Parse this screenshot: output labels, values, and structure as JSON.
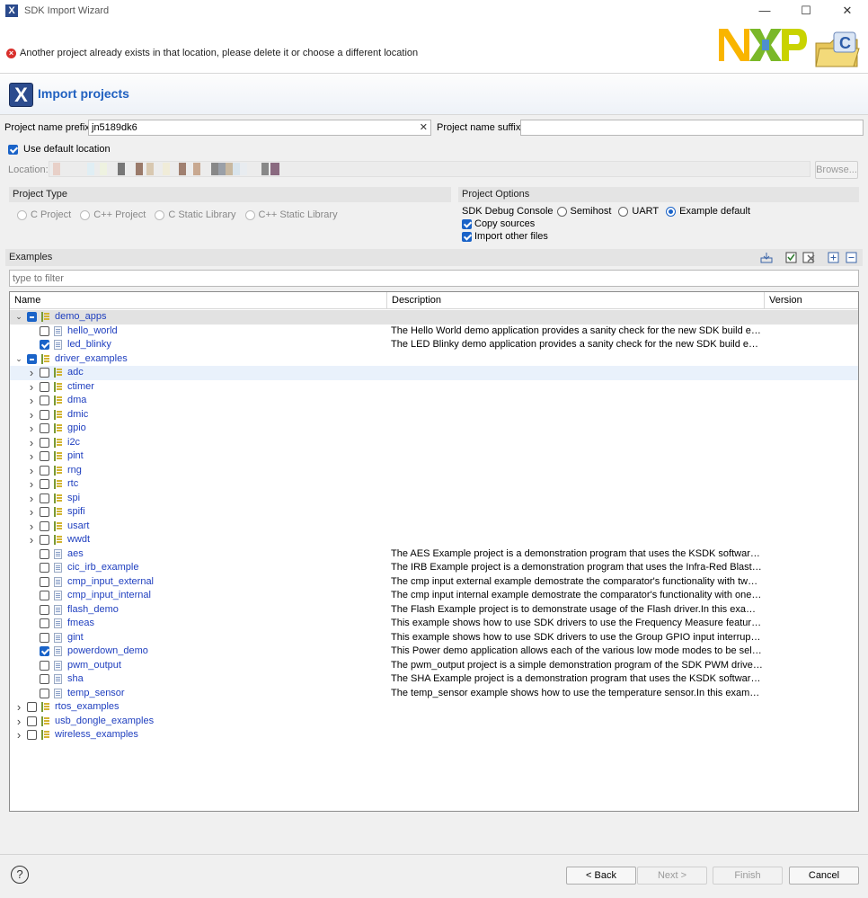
{
  "window": {
    "title": "SDK Import Wizard",
    "minimize": "—",
    "maximize": "☐",
    "close": "✕"
  },
  "banner": {
    "error_message": "Another project already exists in that location, please delete it or choose a different location"
  },
  "header": {
    "title": "Import projects"
  },
  "form": {
    "prefix_label": "Project name prefix:",
    "prefix_value": "jn5189dk6",
    "suffix_label": "Project name suffix:",
    "suffix_value": "",
    "use_default_location": "Use default location",
    "location_label": "Location:",
    "browse": "Browse..."
  },
  "project_type": {
    "title": "Project Type",
    "options": [
      "C Project",
      "C++ Project",
      "C Static Library",
      "C++ Static Library"
    ]
  },
  "project_options": {
    "title": "Project Options",
    "console_label": "SDK Debug Console",
    "console_options": [
      "Semihost",
      "UART",
      "Example default"
    ],
    "copy_sources": "Copy sources",
    "import_other": "Import other files"
  },
  "examples": {
    "title": "Examples",
    "filter_placeholder": "type to filter",
    "columns": [
      "Name",
      "Description",
      "Version"
    ],
    "rows": [
      {
        "level": 0,
        "tw": "open",
        "cb": "partial",
        "icon": "folder",
        "name": "demo_apps",
        "desc": "",
        "sel": true
      },
      {
        "level": 1,
        "tw": "none",
        "cb": "unchecked",
        "icon": "proj",
        "name": "hello_world",
        "desc": "The Hello World demo application provides a sanity check for the new SDK build environment and board bring up."
      },
      {
        "level": 1,
        "tw": "none",
        "cb": "checked",
        "icon": "proj",
        "name": "led_blinky",
        "desc": "The LED Blinky demo application provides a sanity check for the new SDK build environment and board bring up."
      },
      {
        "level": 0,
        "tw": "open",
        "cb": "partial",
        "icon": "folder",
        "name": "driver_examples",
        "desc": ""
      },
      {
        "level": 1,
        "tw": "closed",
        "cb": "unchecked",
        "icon": "folder",
        "name": "adc",
        "desc": "",
        "hov": true
      },
      {
        "level": 1,
        "tw": "closed",
        "cb": "unchecked",
        "icon": "folder",
        "name": "ctimer",
        "desc": ""
      },
      {
        "level": 1,
        "tw": "closed",
        "cb": "unchecked",
        "icon": "folder",
        "name": "dma",
        "desc": ""
      },
      {
        "level": 1,
        "tw": "closed",
        "cb": "unchecked",
        "icon": "folder",
        "name": "dmic",
        "desc": ""
      },
      {
        "level": 1,
        "tw": "closed",
        "cb": "unchecked",
        "icon": "folder",
        "name": "gpio",
        "desc": ""
      },
      {
        "level": 1,
        "tw": "closed",
        "cb": "unchecked",
        "icon": "folder",
        "name": "i2c",
        "desc": ""
      },
      {
        "level": 1,
        "tw": "closed",
        "cb": "unchecked",
        "icon": "folder",
        "name": "pint",
        "desc": ""
      },
      {
        "level": 1,
        "tw": "closed",
        "cb": "unchecked",
        "icon": "folder",
        "name": "rng",
        "desc": ""
      },
      {
        "level": 1,
        "tw": "closed",
        "cb": "unchecked",
        "icon": "folder",
        "name": "rtc",
        "desc": ""
      },
      {
        "level": 1,
        "tw": "closed",
        "cb": "unchecked",
        "icon": "folder",
        "name": "spi",
        "desc": ""
      },
      {
        "level": 1,
        "tw": "closed",
        "cb": "unchecked",
        "icon": "folder",
        "name": "spifi",
        "desc": ""
      },
      {
        "level": 1,
        "tw": "closed",
        "cb": "unchecked",
        "icon": "folder",
        "name": "usart",
        "desc": ""
      },
      {
        "level": 1,
        "tw": "closed",
        "cb": "unchecked",
        "icon": "folder",
        "name": "wwdt",
        "desc": ""
      },
      {
        "level": 1,
        "tw": "none",
        "cb": "unchecked",
        "icon": "proj",
        "name": "aes",
        "desc": "The AES Example project is a demonstration program that uses the KSDK software to encrypt plain text."
      },
      {
        "level": 1,
        "tw": "none",
        "cb": "unchecked",
        "icon": "proj",
        "name": "cic_irb_example",
        "desc": "The IRB Example project is a demonstration program that uses the Infra-Red Blaster (IRB) driver."
      },
      {
        "level": 1,
        "tw": "none",
        "cb": "unchecked",
        "icon": "proj",
        "name": "cmp_input_external",
        "desc": "The cmp input external example demostrate the comparator's functionality with two external inputs."
      },
      {
        "level": 1,
        "tw": "none",
        "cb": "unchecked",
        "icon": "proj",
        "name": "cmp_input_internal",
        "desc": "The cmp input internal example demostrate the comparator's functionality with one external input."
      },
      {
        "level": 1,
        "tw": "none",
        "cb": "unchecked",
        "icon": "proj",
        "name": "flash_demo",
        "desc": "The Flash Example project is to demonstrate usage of the Flash driver.In this example, we will erase."
      },
      {
        "level": 1,
        "tw": "none",
        "cb": "unchecked",
        "icon": "proj",
        "name": "fmeas",
        "desc": "This example shows how to use SDK drivers to use the Frequency Measure feature of SYSCON module."
      },
      {
        "level": 1,
        "tw": "none",
        "cb": "unchecked",
        "icon": "proj",
        "name": "gint",
        "desc": "This example shows how to use SDK drivers to use the Group GPIO input interrupt peripheral."
      },
      {
        "level": 1,
        "tw": "none",
        "cb": "checked",
        "icon": "proj",
        "name": "powerdown_demo",
        "desc": "This Power demo application allows each of the various low mode modes to be selected, and shown."
      },
      {
        "level": 1,
        "tw": "none",
        "cb": "unchecked",
        "icon": "proj",
        "name": "pwm_output",
        "desc": "The pwm_output project is a simple demonstration program of the SDK PWM driver.The project."
      },
      {
        "level": 1,
        "tw": "none",
        "cb": "unchecked",
        "icon": "proj",
        "name": "sha",
        "desc": "The SHA Example project is a demonstration program that uses the KSDK software to generate hash."
      },
      {
        "level": 1,
        "tw": "none",
        "cb": "unchecked",
        "icon": "proj",
        "name": "temp_sensor",
        "desc": "The temp_sensor example shows how to use the temperature sensor.In this example, the code reads."
      },
      {
        "level": 0,
        "tw": "closed",
        "cb": "unchecked",
        "icon": "folder",
        "name": "rtos_examples",
        "desc": ""
      },
      {
        "level": 0,
        "tw": "closed",
        "cb": "unchecked",
        "icon": "folder",
        "name": "usb_dongle_examples",
        "desc": ""
      },
      {
        "level": 0,
        "tw": "closed",
        "cb": "unchecked",
        "icon": "folder",
        "name": "wireless_examples",
        "desc": ""
      }
    ]
  },
  "footer": {
    "help": "?",
    "back": "< Back",
    "next": "Next >",
    "finish": "Finish",
    "cancel": "Cancel"
  },
  "colors": {
    "accent": "#1a63c8",
    "link": "#1f3fbf",
    "error": "#d9302c"
  }
}
